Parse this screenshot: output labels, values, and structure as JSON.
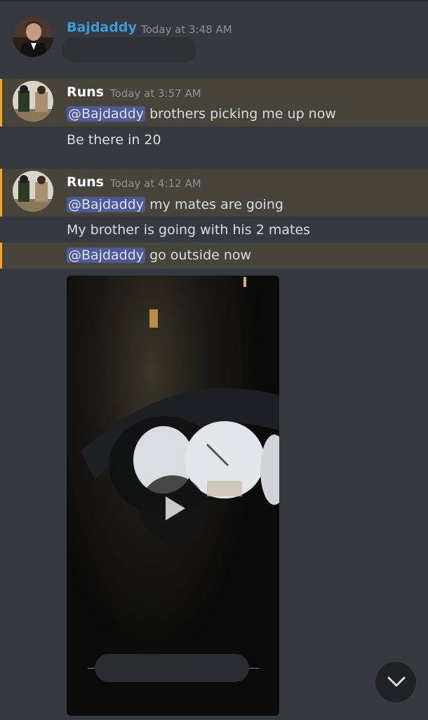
{
  "colors": {
    "background": "#36393f",
    "mention_row": "#46443b",
    "mention_bar": "#faa61a",
    "mention_pill_bg": "#4e5a94",
    "mention_pill_text": "#dee0fc",
    "author_bajdaddy": "#3e9bd6",
    "author_runs": "#ffffff",
    "timestamp": "#8e9297"
  },
  "messages": [
    {
      "author": "Bajdaddy",
      "timestamp": "Today at 3:48 AM"
    },
    {
      "author": "Runs",
      "timestamp": "Today at 3:57 AM",
      "lines": [
        {
          "mention": "@Bajdaddy",
          "text": " brothers picking me up now"
        },
        {
          "text": "Be there in 20"
        }
      ]
    },
    {
      "author": "Runs",
      "timestamp": "Today at 4:12 AM",
      "lines": [
        {
          "mention": "@Bajdaddy",
          "text": " my mates are going"
        },
        {
          "text": "My brother is going with his 2 mates"
        },
        {
          "mention": "@Bajdaddy",
          "text": " go outside now"
        }
      ]
    }
  ],
  "icons": {
    "play": "play-icon",
    "scroll": "chevron-down-icon"
  }
}
